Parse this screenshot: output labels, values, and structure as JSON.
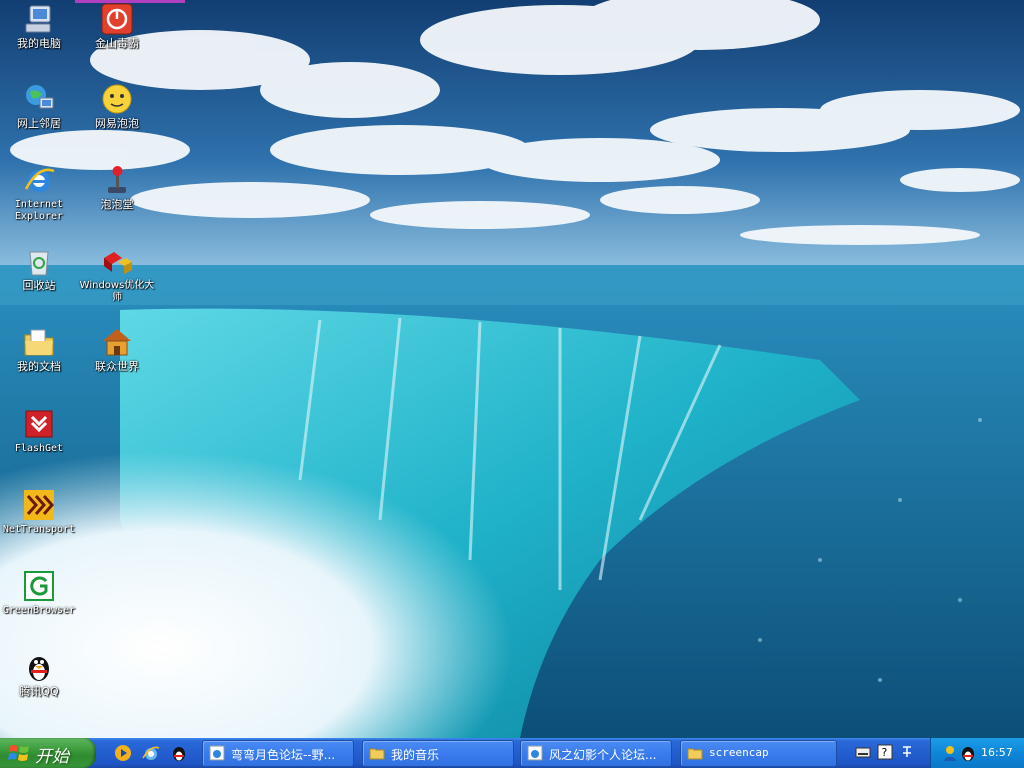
{
  "desktop": {
    "icons": [
      {
        "label": "我的电脑",
        "icon": "my-computer-icon"
      },
      {
        "label": "金山毒霸",
        "icon": "kingsoft-antivirus-icon"
      },
      {
        "label": "网上邻居",
        "icon": "network-neighborhood-icon"
      },
      {
        "label": "网易泡泡",
        "icon": "netease-popo-icon"
      },
      {
        "label": "Internet Explorer",
        "icon": "internet-explorer-icon"
      },
      {
        "label": "泡泡堂",
        "icon": "joystick-icon"
      },
      {
        "label": "回收站",
        "icon": "recycle-bin-icon"
      },
      {
        "label": "Windows优化大师",
        "icon": "windows-optimizer-icon"
      },
      {
        "label": "我的文档",
        "icon": "my-documents-icon"
      },
      {
        "label": "联众世界",
        "icon": "ourgame-house-icon"
      },
      {
        "label": "FlashGet",
        "icon": "flashget-icon"
      },
      {
        "label": "NetTransport",
        "icon": "nettransport-icon"
      },
      {
        "label": "GreenBrowser",
        "icon": "greenbrowser-icon"
      },
      {
        "label": "腾讯QQ",
        "icon": "qq-penguin-icon"
      }
    ]
  },
  "taskbar": {
    "start_label": "开始",
    "tasks": [
      {
        "label": "弯弯月色论坛--野...",
        "icon": "ie-page-icon"
      },
      {
        "label": "我的音乐",
        "icon": "folder-icon"
      },
      {
        "label": "风之幻影个人论坛...",
        "icon": "ie-page-icon"
      },
      {
        "label": "screencap",
        "icon": "folder-icon"
      }
    ],
    "clock": "16:57"
  },
  "colors": {
    "taskbar": "#245edb",
    "start": "#3c9a3c",
    "tray": "#0e86d9"
  }
}
